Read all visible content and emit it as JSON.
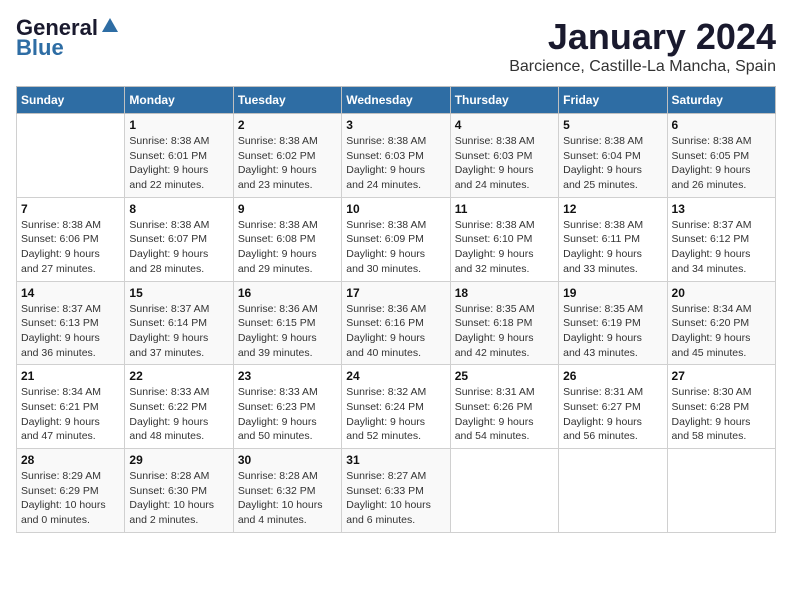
{
  "logo": {
    "line1": "General",
    "line2": "Blue"
  },
  "title": "January 2024",
  "location": "Barcience, Castille-La Mancha, Spain",
  "days_of_week": [
    "Sunday",
    "Monday",
    "Tuesday",
    "Wednesday",
    "Thursday",
    "Friday",
    "Saturday"
  ],
  "weeks": [
    [
      {
        "day": "",
        "info": ""
      },
      {
        "day": "1",
        "info": "Sunrise: 8:38 AM\nSunset: 6:01 PM\nDaylight: 9 hours\nand 22 minutes."
      },
      {
        "day": "2",
        "info": "Sunrise: 8:38 AM\nSunset: 6:02 PM\nDaylight: 9 hours\nand 23 minutes."
      },
      {
        "day": "3",
        "info": "Sunrise: 8:38 AM\nSunset: 6:03 PM\nDaylight: 9 hours\nand 24 minutes."
      },
      {
        "day": "4",
        "info": "Sunrise: 8:38 AM\nSunset: 6:03 PM\nDaylight: 9 hours\nand 24 minutes."
      },
      {
        "day": "5",
        "info": "Sunrise: 8:38 AM\nSunset: 6:04 PM\nDaylight: 9 hours\nand 25 minutes."
      },
      {
        "day": "6",
        "info": "Sunrise: 8:38 AM\nSunset: 6:05 PM\nDaylight: 9 hours\nand 26 minutes."
      }
    ],
    [
      {
        "day": "7",
        "info": ""
      },
      {
        "day": "8",
        "info": "Sunrise: 8:38 AM\nSunset: 6:07 PM\nDaylight: 9 hours\nand 28 minutes."
      },
      {
        "day": "9",
        "info": "Sunrise: 8:38 AM\nSunset: 6:08 PM\nDaylight: 9 hours\nand 29 minutes."
      },
      {
        "day": "10",
        "info": "Sunrise: 8:38 AM\nSunset: 6:09 PM\nDaylight: 9 hours\nand 30 minutes."
      },
      {
        "day": "11",
        "info": "Sunrise: 8:38 AM\nSunset: 6:10 PM\nDaylight: 9 hours\nand 32 minutes."
      },
      {
        "day": "12",
        "info": "Sunrise: 8:38 AM\nSunset: 6:11 PM\nDaylight: 9 hours\nand 33 minutes."
      },
      {
        "day": "13",
        "info": "Sunrise: 8:37 AM\nSunset: 6:12 PM\nDaylight: 9 hours\nand 34 minutes."
      }
    ],
    [
      {
        "day": "14",
        "info": ""
      },
      {
        "day": "15",
        "info": "Sunrise: 8:37 AM\nSunset: 6:14 PM\nDaylight: 9 hours\nand 37 minutes."
      },
      {
        "day": "16",
        "info": "Sunrise: 8:36 AM\nSunset: 6:15 PM\nDaylight: 9 hours\nand 39 minutes."
      },
      {
        "day": "17",
        "info": "Sunrise: 8:36 AM\nSunset: 6:16 PM\nDaylight: 9 hours\nand 40 minutes."
      },
      {
        "day": "18",
        "info": "Sunrise: 8:35 AM\nSunset: 6:18 PM\nDaylight: 9 hours\nand 42 minutes."
      },
      {
        "day": "19",
        "info": "Sunrise: 8:35 AM\nSunset: 6:19 PM\nDaylight: 9 hours\nand 43 minutes."
      },
      {
        "day": "20",
        "info": "Sunrise: 8:34 AM\nSunset: 6:20 PM\nDaylight: 9 hours\nand 45 minutes."
      }
    ],
    [
      {
        "day": "21",
        "info": ""
      },
      {
        "day": "22",
        "info": "Sunrise: 8:33 AM\nSunset: 6:22 PM\nDaylight: 9 hours\nand 48 minutes."
      },
      {
        "day": "23",
        "info": "Sunrise: 8:33 AM\nSunset: 6:23 PM\nDaylight: 9 hours\nand 50 minutes."
      },
      {
        "day": "24",
        "info": "Sunrise: 8:32 AM\nSunset: 6:24 PM\nDaylight: 9 hours\nand 52 minutes."
      },
      {
        "day": "25",
        "info": "Sunrise: 8:31 AM\nSunset: 6:26 PM\nDaylight: 9 hours\nand 54 minutes."
      },
      {
        "day": "26",
        "info": "Sunrise: 8:31 AM\nSunset: 6:27 PM\nDaylight: 9 hours\nand 56 minutes."
      },
      {
        "day": "27",
        "info": "Sunrise: 8:30 AM\nSunset: 6:28 PM\nDaylight: 9 hours\nand 58 minutes."
      }
    ],
    [
      {
        "day": "28",
        "info": "Sunrise: 8:29 AM\nSunset: 6:29 PM\nDaylight: 10 hours\nand 0 minutes."
      },
      {
        "day": "29",
        "info": "Sunrise: 8:28 AM\nSunset: 6:30 PM\nDaylight: 10 hours\nand 2 minutes."
      },
      {
        "day": "30",
        "info": "Sunrise: 8:28 AM\nSunset: 6:32 PM\nDaylight: 10 hours\nand 4 minutes."
      },
      {
        "day": "31",
        "info": "Sunrise: 8:27 AM\nSunset: 6:33 PM\nDaylight: 10 hours\nand 6 minutes."
      },
      {
        "day": "",
        "info": ""
      },
      {
        "day": "",
        "info": ""
      },
      {
        "day": "",
        "info": ""
      }
    ]
  ],
  "week1_sunday_info": "Sunrise: 8:38 AM\nSunset: 6:06 PM\nDaylight: 9 hours\nand 27 minutes.",
  "week2_sunday_info": "Sunrise: 8:37 AM\nSunset: 6:13 PM\nDaylight: 9 hours\nand 36 minutes.",
  "week3_sunday_info": "Sunrise: 8:34 AM\nSunset: 6:21 PM\nDaylight: 9 hours\nand 47 minutes."
}
